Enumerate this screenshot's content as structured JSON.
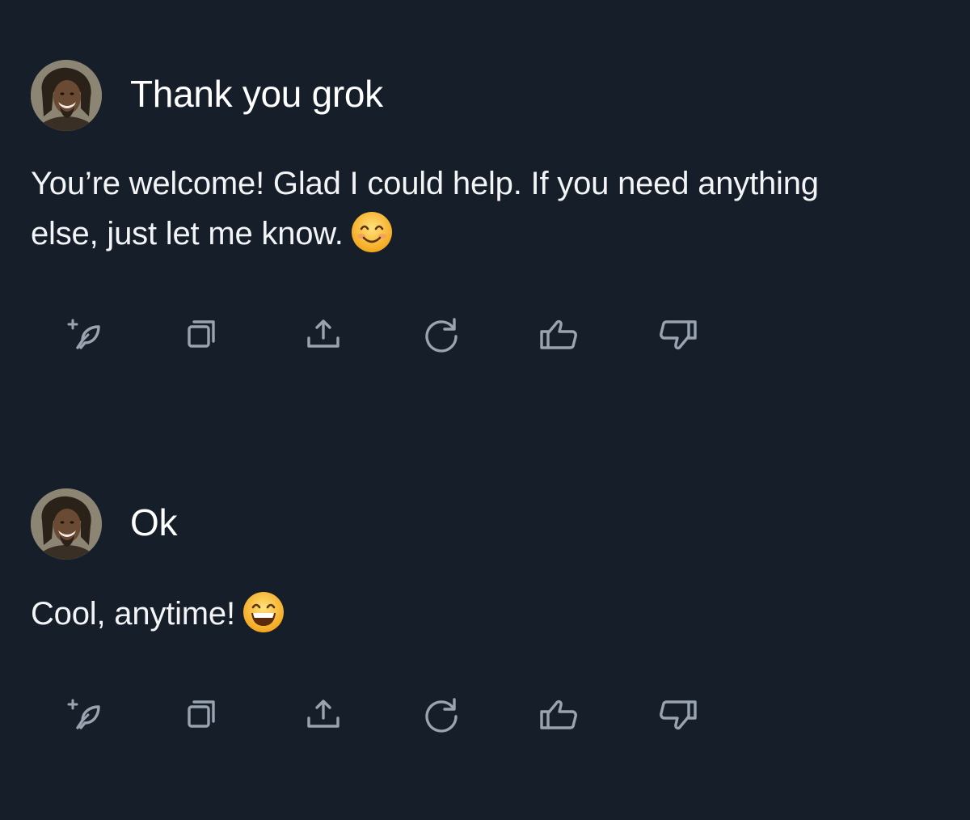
{
  "conversation": [
    {
      "user": {
        "text": "Thank you grok"
      },
      "reply": {
        "text": "You’re welcome! Glad I could help. If you need anything else, just let me know.",
        "emoji": "smiling-face-with-smiling-eyes"
      },
      "actions": [
        "grok-quill-icon",
        "copy-icon",
        "share-icon",
        "regenerate-icon",
        "thumbs-up-icon",
        "thumbs-down-icon"
      ]
    },
    {
      "user": {
        "text": "Ok"
      },
      "reply": {
        "text": "Cool, anytime!",
        "emoji": "grinning-face-with-smiling-eyes"
      },
      "actions": [
        "grok-quill-icon",
        "copy-icon",
        "share-icon",
        "regenerate-icon",
        "thumbs-up-icon",
        "thumbs-down-icon"
      ]
    }
  ],
  "colors": {
    "background": "#161e29",
    "text": "#ffffff",
    "icon": "#9aa4b1"
  }
}
